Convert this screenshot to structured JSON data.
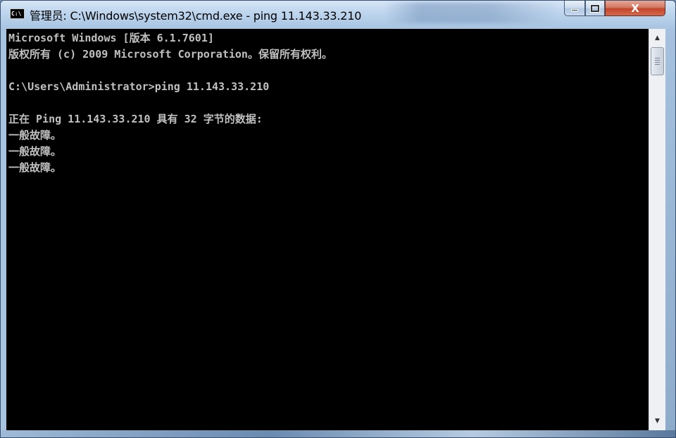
{
  "window": {
    "title": "管理员: C:\\Windows\\system32\\cmd.exe - ping  11.143.33.210",
    "icon_text": "C:\\",
    "buttons": {
      "minimize_icon": "minimize-icon",
      "maximize_icon": "maximize-icon",
      "close_label": "X"
    }
  },
  "console": {
    "background": "#000000",
    "foreground": "#c0c0c0",
    "lines": [
      "Microsoft Windows [版本 6.1.7601]",
      "版权所有 (c) 2009 Microsoft Corporation。保留所有权利。",
      "",
      "C:\\Users\\Administrator>ping 11.143.33.210",
      "",
      "正在 Ping 11.143.33.210 具有 32 字节的数据:",
      "一般故障。",
      "一般故障。",
      "一般故障。"
    ]
  },
  "scrollbar": {
    "up_icon": "arrow-up-icon",
    "down_icon": "arrow-down-icon"
  }
}
